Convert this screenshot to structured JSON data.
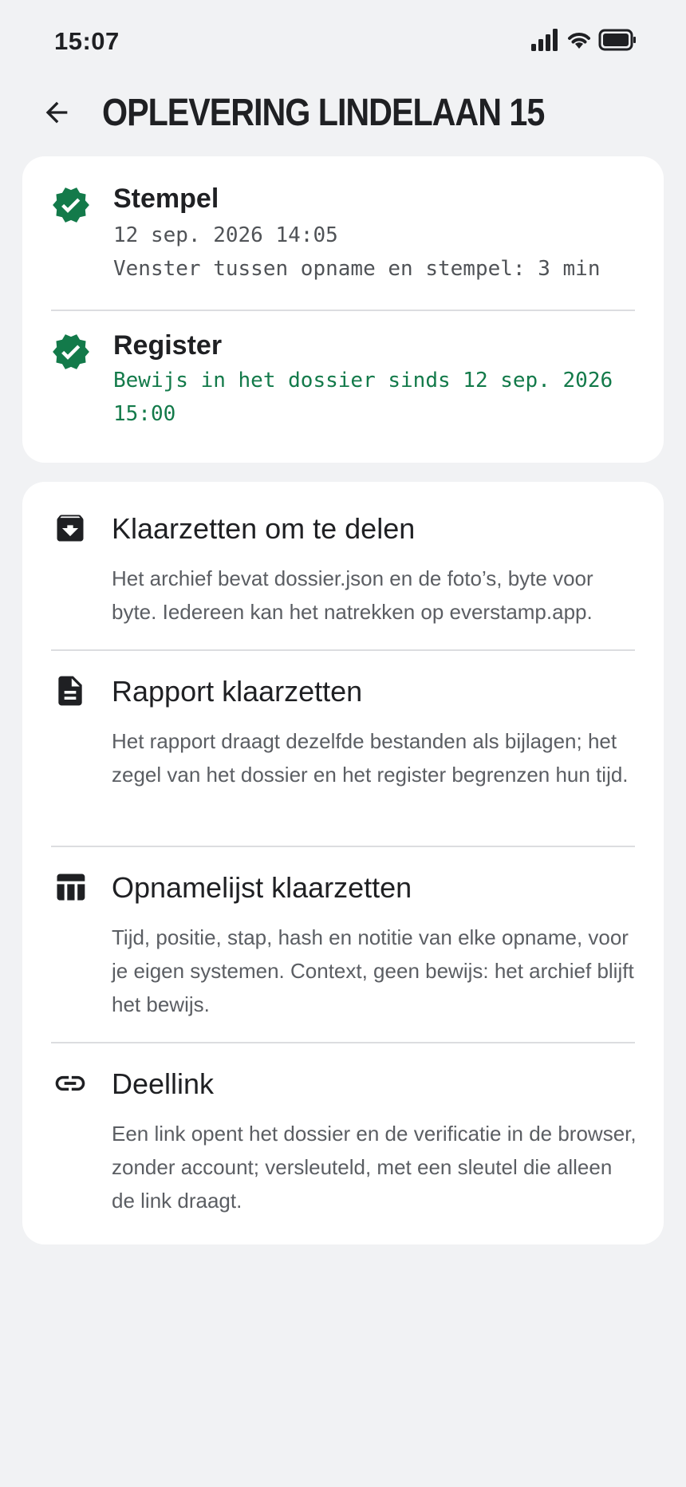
{
  "status_bar": {
    "time": "15:07",
    "icons": [
      "signal-icon",
      "wifi-icon",
      "battery-icon"
    ]
  },
  "header": {
    "back_icon": "arrow-back-icon",
    "title": "OPLEVERING LINDELAAN 15"
  },
  "status_card": {
    "accent_color": "#137a4a",
    "items": [
      {
        "icon": "verified-badge-icon",
        "title": "Stempel",
        "lines": [
          "12 sep. 2026 14:05",
          "Venster tussen opname en stempel: 3 min"
        ]
      },
      {
        "icon": "verified-badge-icon",
        "title": "Register",
        "lines": [
          "Bewijs in het dossier sinds 12 sep. 2026 15:00"
        ]
      }
    ]
  },
  "actions": [
    {
      "icon": "archive-download-icon",
      "title": "Klaarzetten om te delen",
      "description": "Het archief bevat dossier.json en de foto’s, byte voor byte. Iedereen kan het natrekken op everstamp.app."
    },
    {
      "icon": "document-icon",
      "title": "Rapport klaarzetten",
      "description": "Het rapport draagt dezelfde bestanden als bijlagen; het zegel van het dossier en het register begrenzen hun tijd."
    },
    {
      "icon": "table-icon",
      "title": "Opnamelijst klaarzetten",
      "description": "Tijd, positie, stap, hash en notitie van elke opname, voor je eigen systemen. Context, geen bewijs: het archief blijft het bewijs."
    },
    {
      "icon": "link-icon",
      "title": "Deellink",
      "description": "Een link opent het dossier en de verificatie in de browser, zonder account; versleuteld, met een sleutel die alleen de link draagt."
    }
  ]
}
